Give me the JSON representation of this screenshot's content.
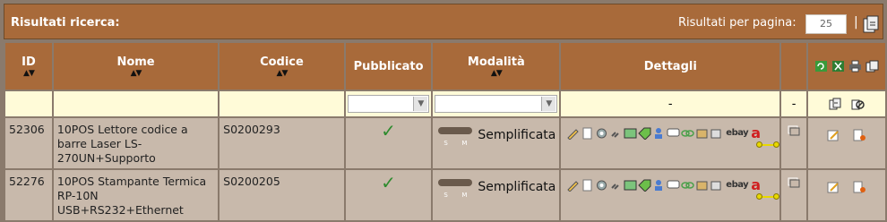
{
  "header": {
    "title": "Risultati ricerca:",
    "results_per_page_label": "Risultati per pagina:",
    "results_per_page_value": "25",
    "separator": "|"
  },
  "columns": {
    "id": "ID",
    "name": "Nome",
    "code": "Codice",
    "published": "Pubblicato",
    "mode": "Modalità",
    "details": "Dettagli"
  },
  "filters": {
    "details_value": "-",
    "extra_value": "-"
  },
  "toggle_labels": {
    "left": "S",
    "right": "M"
  },
  "rows": [
    {
      "id": "52306",
      "name": "10POS Lettore codice a barre Laser LS-270UN+Supporto",
      "code": "S0200293",
      "published": "✓",
      "mode": "Semplificata",
      "ebay": "ebay",
      "amazon": "a"
    },
    {
      "id": "52276",
      "name": "10POS Stampante Termica RP-10N USB+RS232+Ethernet",
      "code": "S0200205",
      "published": "✓",
      "mode": "Semplificata",
      "ebay": "ebay",
      "amazon": "a"
    }
  ],
  "colors": {
    "header_brown": "#a86a3a",
    "filter_yellow": "#fffbd8",
    "row_beige": "#c8b9ab",
    "check_green": "#2e8b2e",
    "amazon_red": "#d02020",
    "link_yellow": "#e8d800"
  }
}
